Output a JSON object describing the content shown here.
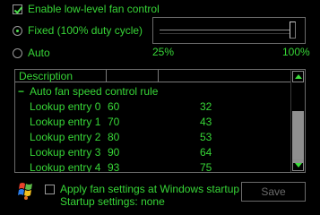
{
  "enable": {
    "label": "Enable low-level fan control",
    "checked": true
  },
  "mode": {
    "fixed": {
      "label": "Fixed (100% duty cycle)",
      "selected": true
    },
    "auto": {
      "label": "Auto",
      "selected": false
    }
  },
  "duty_slider": {
    "value_percent": 100,
    "min_label": "25%",
    "max_label": "100%"
  },
  "table": {
    "columns": [
      "Description",
      "",
      ""
    ],
    "group": {
      "expander": "−",
      "label": "Auto fan speed control rule"
    },
    "rows": [
      {
        "name": "Lookup entry 0",
        "a": "60",
        "b": "32"
      },
      {
        "name": "Lookup entry 1",
        "a": "70",
        "b": "43"
      },
      {
        "name": "Lookup entry 2",
        "a": "80",
        "b": "53"
      },
      {
        "name": "Lookup entry 3",
        "a": "90",
        "b": "64"
      },
      {
        "name": "Lookup entry 4",
        "a": "93",
        "b": "75"
      }
    ]
  },
  "apply": {
    "label": "Apply fan settings at Windows startup",
    "checked": false
  },
  "startup": {
    "label": "Startup settings:",
    "value": "none"
  },
  "save_label": "Save",
  "colors": {
    "text": "#37d637",
    "background": "#000000",
    "disabled": "#6a6a6a"
  }
}
